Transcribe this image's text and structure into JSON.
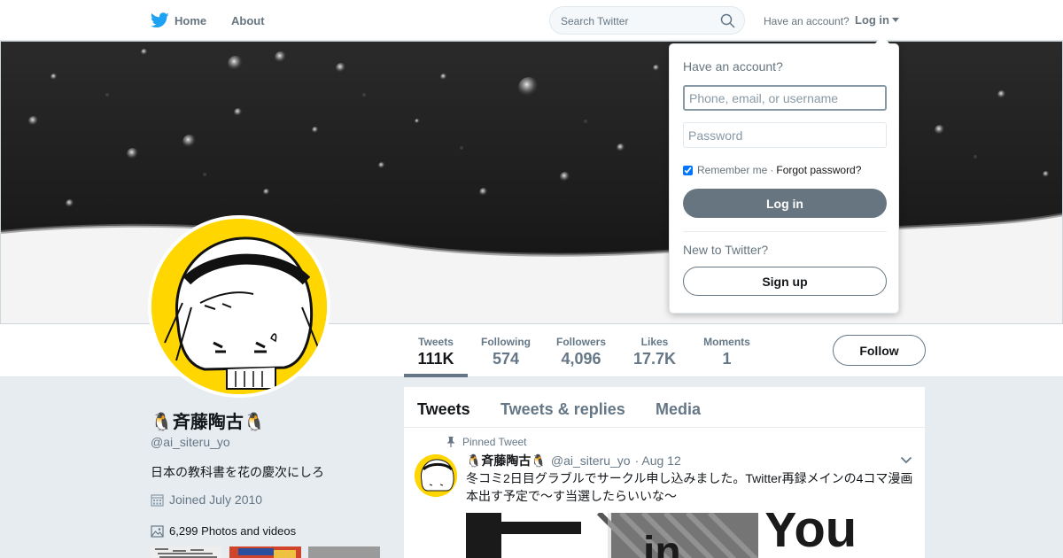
{
  "nav": {
    "home_label": "Home",
    "about_label": "About",
    "search_placeholder": "Search Twitter",
    "have_account": "Have an account?",
    "login_label": "Log in"
  },
  "profile": {
    "name": "🐧斉藤陶古🐧",
    "handle": "@ai_siteru_yo",
    "bio": "日本の教科書を花の慶次にしろ",
    "joined": "Joined July 2010",
    "photos": "6,299 Photos and videos"
  },
  "stats": [
    {
      "label": "Tweets",
      "value": "111K"
    },
    {
      "label": "Following",
      "value": "574"
    },
    {
      "label": "Followers",
      "value": "4,096"
    },
    {
      "label": "Likes",
      "value": "17.7K"
    },
    {
      "label": "Moments",
      "value": "1"
    }
  ],
  "follow_label": "Follow",
  "timeline": {
    "tabs": [
      "Tweets",
      "Tweets & replies",
      "Media"
    ],
    "pinned_label": "Pinned Tweet",
    "tweet": {
      "name": "🐧斉藤陶古🐧",
      "handle": "@ai_siteru_yo",
      "date": "· Aug 12",
      "text": "冬コミ2日目グラブルでサークル申し込みました。Twitter再録メインの4コマ漫画本出す予定で～す当選したらいいな～"
    }
  },
  "login_dropdown": {
    "title": "Have an account?",
    "username_placeholder": "Phone, email, or username",
    "password_placeholder": "Password",
    "remember_label": "Remember me",
    "separator": "·",
    "forgot_label": "Forgot password?",
    "remember_checked": true,
    "login_button": "Log in",
    "new_label": "New to Twitter?",
    "signup_button": "Sign up"
  },
  "colors": {
    "avatar_bg": "#ffd600",
    "twitter_blue": "#1da1f2",
    "button_gray": "#66757f"
  }
}
